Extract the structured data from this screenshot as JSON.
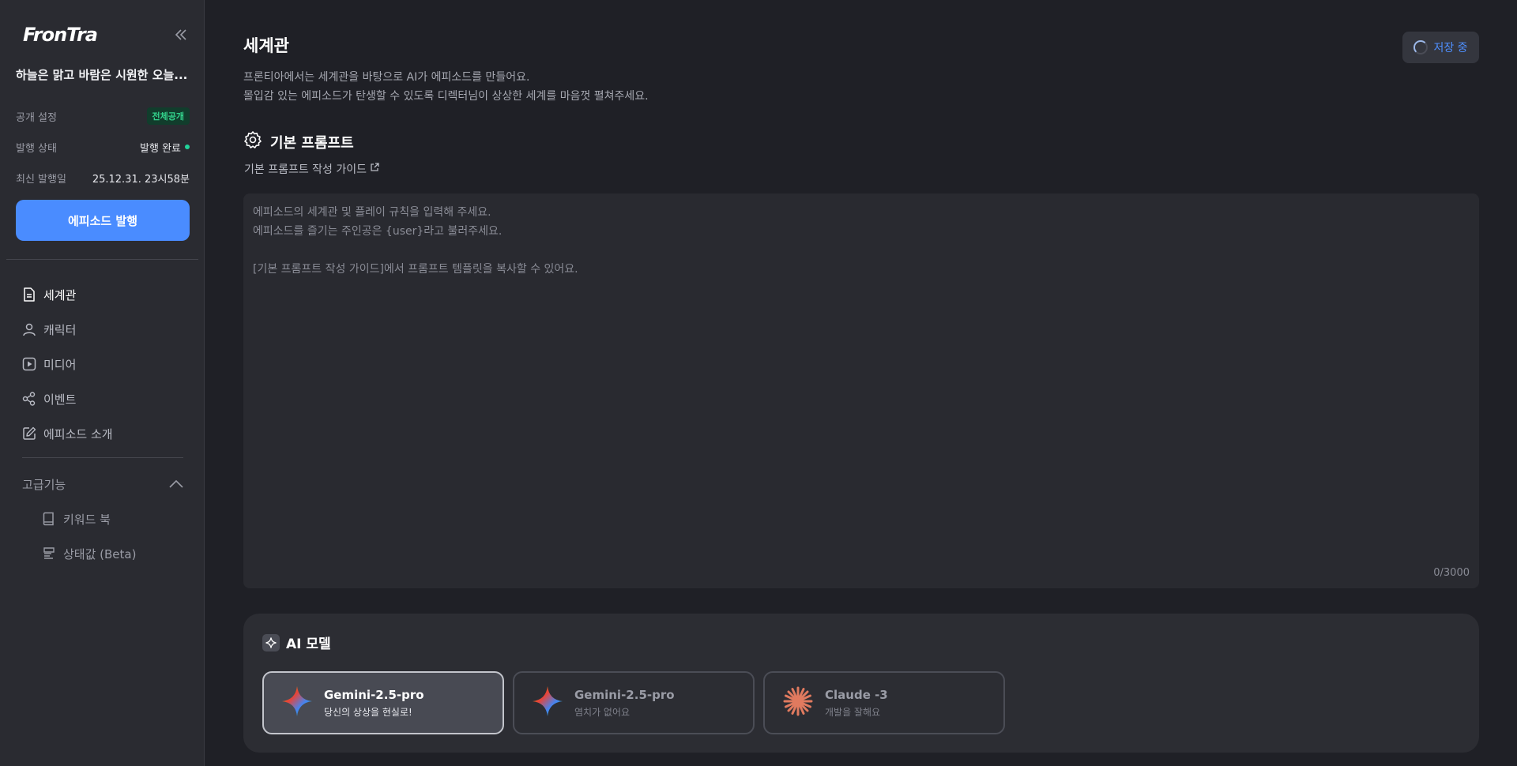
{
  "sidebar": {
    "logo": "FronTra",
    "episode_title": "하늘은 맑고 바람은 시원한 오늘...",
    "meta": [
      {
        "key": "공개 설정",
        "value": "전체공개"
      },
      {
        "key": "발행 상태",
        "value": "발행 완료"
      },
      {
        "key": "최신 발행일",
        "value": "25.12.31. 23시58분"
      }
    ],
    "publish_button": "에피소드 발행",
    "nav": [
      {
        "label": "세계관",
        "icon": "document-icon"
      },
      {
        "label": "캐릭터",
        "icon": "user-icon"
      },
      {
        "label": "미디어",
        "icon": "play-icon"
      },
      {
        "label": "이벤트",
        "icon": "share-nodes-icon"
      },
      {
        "label": "에피소드 소개",
        "icon": "edit-icon"
      }
    ],
    "advanced": {
      "label": "고급기능",
      "items": [
        {
          "label": "키워드 북",
          "icon": "book-icon"
        },
        {
          "label": "상태값 (Beta)",
          "icon": "status-icon"
        }
      ]
    }
  },
  "header": {
    "title": "세계관",
    "desc_line1": "프론티아에서는 세계관을 바탕으로 AI가 에피소드를 만들어요.",
    "desc_line2": "몰입감 있는 에피소드가 탄생할 수 있도록 디렉터님이 상상한 세계를 마음껏 펼쳐주세요.",
    "saving_label": "저장 중"
  },
  "prompt": {
    "section_title": "기본 프롬프트",
    "guide_link": "기본 프롬프트 작성 가이드",
    "placeholder": "에피소드의 세계관 및 플레이 규칙을 입력해 주세요.\n에피소드를 즐기는 주인공은 {user}라고 불러주세요.\n\n[기본 프롬프트 작성 가이드]에서 프롬프트 템플릿을 복사할 수 있어요.",
    "counter": "0/3000"
  },
  "ai_model": {
    "title": "AI 모델",
    "models": [
      {
        "name": "Gemini-2.5-pro",
        "desc": "당신의 상상을 현실로!",
        "icon": "gemini-icon",
        "selected": true
      },
      {
        "name": "Gemini-2.5-pro",
        "desc": "염치가 없어요",
        "icon": "gemini-icon",
        "selected": false
      },
      {
        "name": "Claude -3",
        "desc": "개발을 잘해요",
        "icon": "claude-icon",
        "selected": false
      }
    ]
  },
  "colors": {
    "accent": "#4a8cff",
    "public_badge": "#33d38c",
    "status_dot": "#22d39a",
    "claude": "#e07a5f"
  }
}
